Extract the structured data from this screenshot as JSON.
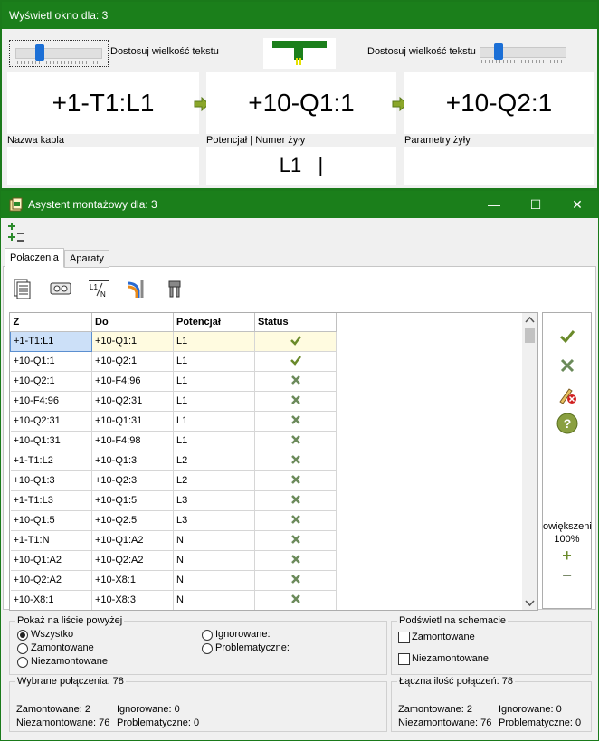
{
  "win1": {
    "title": "Wyświetl okno dla: 3",
    "slider_left_label": "Dostosuj wielkość tekstu",
    "slider_right_label": "Dostosuj wielkość tekstu",
    "boxes": [
      "+1-T1:L1",
      "+10-Q1:1",
      "+10-Q2:1"
    ],
    "sub_labels": [
      "Nazwa kabla",
      "Potencjał  |  Numer żyły",
      "Parametry żyły"
    ],
    "sub_value": "L1   |"
  },
  "win2": {
    "title": "Asystent montażowy dla: 3",
    "minimize": "—",
    "maximize": "☐",
    "close": "✕",
    "tabs": [
      "Połaczenia",
      "Aparaty"
    ],
    "columns": [
      "Z",
      "Do",
      "Potencjał",
      "Status"
    ],
    "rows": [
      {
        "z": "+1-T1:L1",
        "do": "+10-Q1:1",
        "pot": "L1",
        "status": "ok"
      },
      {
        "z": "+10-Q1:1",
        "do": "+10-Q2:1",
        "pot": "L1",
        "status": "ok"
      },
      {
        "z": "+10-Q2:1",
        "do": "+10-F4:96",
        "pot": "L1",
        "status": "x"
      },
      {
        "z": "+10-F4:96",
        "do": "+10-Q2:31",
        "pot": "L1",
        "status": "x"
      },
      {
        "z": "+10-Q2:31",
        "do": "+10-Q1:31",
        "pot": "L1",
        "status": "x"
      },
      {
        "z": "+10-Q1:31",
        "do": "+10-F4:98",
        "pot": "L1",
        "status": "x"
      },
      {
        "z": "+1-T1:L2",
        "do": "+10-Q1:3",
        "pot": "L2",
        "status": "x"
      },
      {
        "z": "+10-Q1:3",
        "do": "+10-Q2:3",
        "pot": "L2",
        "status": "x"
      },
      {
        "z": "+1-T1:L3",
        "do": "+10-Q1:5",
        "pot": "L3",
        "status": "x"
      },
      {
        "z": "+10-Q1:5",
        "do": "+10-Q2:5",
        "pot": "L3",
        "status": "x"
      },
      {
        "z": "+1-T1:N",
        "do": "+10-Q1:A2",
        "pot": "N",
        "status": "x"
      },
      {
        "z": "+10-Q1:A2",
        "do": "+10-Q2:A2",
        "pot": "N",
        "status": "x"
      },
      {
        "z": "+10-Q2:A2",
        "do": "+10-X8:1",
        "pot": "N",
        "status": "x"
      },
      {
        "z": "+10-X8:1",
        "do": "+10-X8:3",
        "pot": "N",
        "status": "x"
      }
    ],
    "zoom_label": "owiększeni",
    "zoom_value": "100%",
    "zoom_plus": "+",
    "zoom_minus": "−",
    "show_group": {
      "title": "Pokaż na liście powyżej",
      "options": [
        "Wszystko",
        "Zamontowane",
        "Niezamontowane",
        "Ignorowane:",
        "Problematyczne:"
      ],
      "selected": "Wszystko"
    },
    "highlight_group": {
      "title": "Podświetl na schemacie",
      "options": [
        "Zamontowane",
        "Niezamontowane"
      ]
    },
    "selected_stats": {
      "title": "Wybrane połączenia: 78",
      "mounted": "Zamontowane: 2",
      "ignored": "Ignorowane: 0",
      "unmounted": "Niezamontowane: 76",
      "problematic": "Problematyczne: 0"
    },
    "total_stats": {
      "title": "Łączna ilość połączeń: 78",
      "mounted": "Zamontowane: 2",
      "ignored": "Ignorowane: 0",
      "unmounted": "Niezamontowane: 76",
      "problematic": "Problematyczne: 0"
    }
  },
  "colors": {
    "title_bar": "#1b7f1b",
    "selection": "#cce0f8",
    "check_green": "#6a8a2a",
    "x_gray": "#6b8a5a"
  }
}
